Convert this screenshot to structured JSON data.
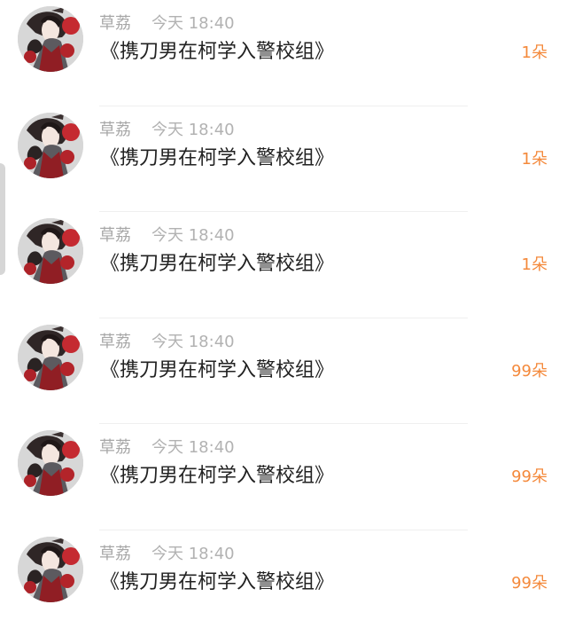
{
  "items": [
    {
      "user": "草荔",
      "time": "今天 18:40",
      "title": "《携刀男在柯学入警校组》",
      "count": "1朵"
    },
    {
      "user": "草荔",
      "time": "今天 18:40",
      "title": "《携刀男在柯学入警校组》",
      "count": "1朵"
    },
    {
      "user": "草荔",
      "time": "今天 18:40",
      "title": "《携刀男在柯学入警校组》",
      "count": "1朵"
    },
    {
      "user": "草荔",
      "time": "今天 18:40",
      "title": "《携刀男在柯学入警校组》",
      "count": "99朵"
    },
    {
      "user": "草荔",
      "time": "今天 18:40",
      "title": "《携刀男在柯学入警校组》",
      "count": "99朵"
    },
    {
      "user": "草荔",
      "time": "今天 18:40",
      "title": "《携刀男在柯学入警校组》",
      "count": "99朵"
    }
  ],
  "colors": {
    "accent": "#f4893b",
    "muted_text": "#b2b2b2",
    "primary_text": "#222222"
  }
}
